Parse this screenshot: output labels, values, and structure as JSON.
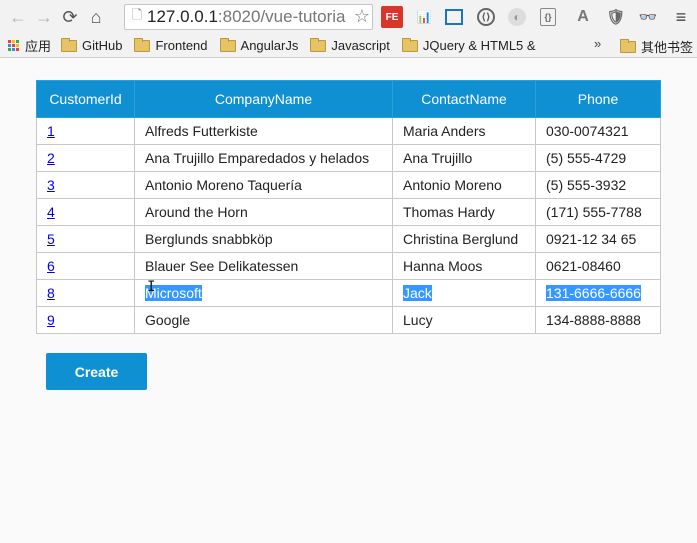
{
  "browser": {
    "url_host": "127.0.0.1",
    "url_rest": ":8020/vue-tutoria",
    "icons": {
      "back": "←",
      "forward": "→",
      "reload": "⟳",
      "home": "⌂",
      "star": "☆",
      "menu": "≡",
      "page": "🗋"
    },
    "extensions": [
      "FE",
      "📊",
      "▭",
      "⟨⟩",
      "◐",
      "{}",
      "A",
      "🛡",
      "👓"
    ]
  },
  "bookmarks": {
    "apps_label": "应用",
    "items": [
      "GitHub",
      "Frontend",
      "AngularJs",
      "Javascript",
      "JQuery & HTML5 &"
    ],
    "overflow": "»",
    "other_label": "其他书签"
  },
  "table": {
    "headers": [
      "CustomerId",
      "CompanyName",
      "ContactName",
      "Phone"
    ],
    "rows": [
      {
        "id": "1",
        "company": "Alfreds Futterkiste",
        "contact": "Maria Anders",
        "phone": "030-0074321",
        "selected": false
      },
      {
        "id": "2",
        "company": "Ana Trujillo Emparedados y helados",
        "contact": "Ana Trujillo",
        "phone": "(5) 555-4729",
        "selected": false
      },
      {
        "id": "3",
        "company": "Antonio Moreno Taquería",
        "contact": "Antonio Moreno",
        "phone": "(5) 555-3932",
        "selected": false
      },
      {
        "id": "4",
        "company": "Around the Horn",
        "contact": "Thomas Hardy",
        "phone": "(171) 555-7788",
        "selected": false
      },
      {
        "id": "5",
        "company": "Berglunds snabbköp",
        "contact": "Christina Berglund",
        "phone": "0921-12 34 65",
        "selected": false
      },
      {
        "id": "6",
        "company": "Blauer See Delikatessen",
        "contact": "Hanna Moos",
        "phone": "0621-08460",
        "selected": false
      },
      {
        "id": "8",
        "company": "Microsoft",
        "contact": "Jack",
        "phone": "131-6666-6666",
        "selected": true
      },
      {
        "id": "9",
        "company": "Google",
        "contact": "Lucy",
        "phone": "134-8888-8888",
        "selected": false
      }
    ]
  },
  "create_label": "Create",
  "colors": {
    "header_bg": "#0e90d2",
    "button_bg": "#0e90d2",
    "selection": "#3399ff",
    "link": "#0000ee"
  }
}
